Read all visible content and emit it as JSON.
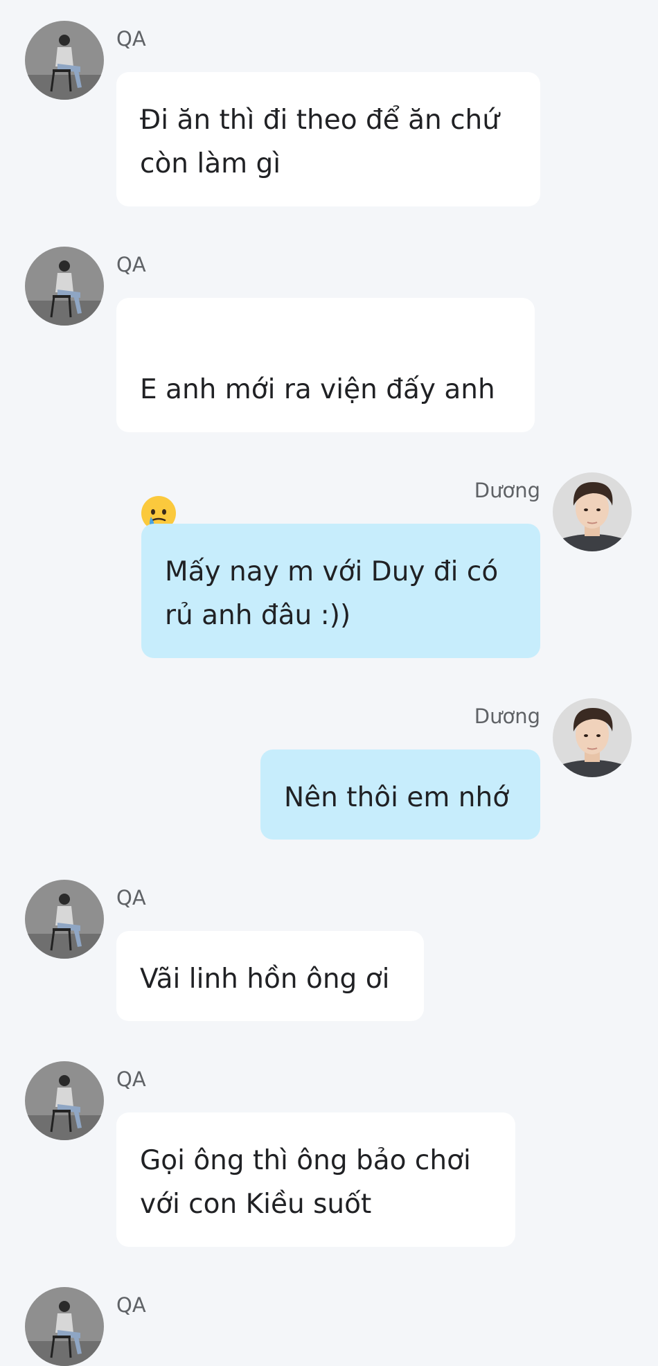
{
  "chat": {
    "messages": [
      {
        "side": "left",
        "sender": "QA",
        "text": "Đi ăn thì đi theo để ăn chứ\ncòn làm gì"
      },
      {
        "side": "left",
        "sender": "QA",
        "text": "E anh mới ra viện đấy anh",
        "emoji": "face-holding-back-tears"
      },
      {
        "side": "right",
        "sender": "Dương",
        "text": "Mấy nay m với Duy đi có\nrủ anh đâu :))"
      },
      {
        "side": "right",
        "sender": "Dương",
        "text": "Nên thôi em nhớ"
      },
      {
        "side": "left",
        "sender": "QA",
        "text": "Vãi linh hồn ông ơi"
      },
      {
        "side": "left",
        "sender": "QA",
        "text": "Gọi ông thì ông bảo chơi\nvới con Kiều suốt"
      },
      {
        "side": "left",
        "sender": "QA"
      }
    ]
  },
  "colors": {
    "background": "#f4f6f9",
    "incoming_bubble": "#ffffff",
    "outgoing_bubble": "#c7edfc",
    "sender_text": "#5f6266",
    "message_text": "#202124"
  },
  "icons": {
    "qa_avatar": "person-sitting-on-chair-photo-avatar",
    "duong_avatar": "young-man-portrait-photo-avatar",
    "emoji": "face-holding-back-tears-emoji"
  }
}
